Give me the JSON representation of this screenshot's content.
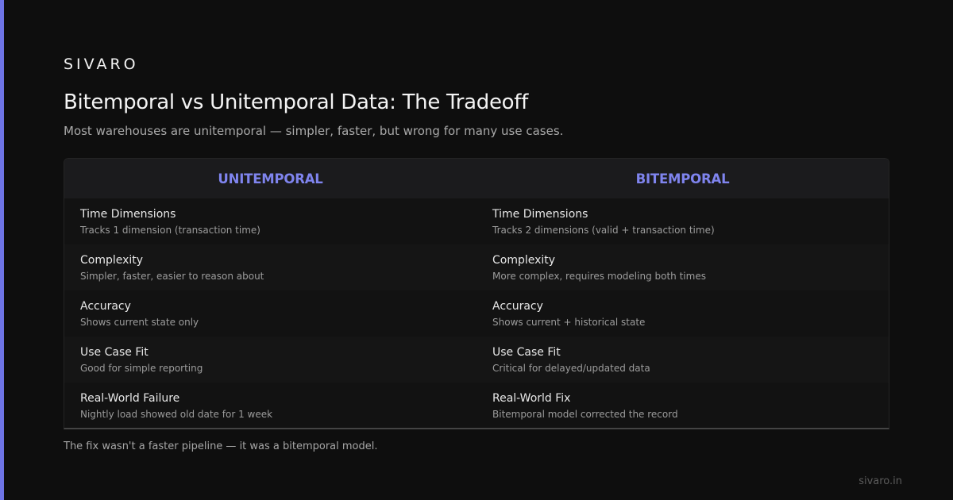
{
  "brand": "SIVARO",
  "title": "Bitemporal vs Unitemporal Data: The Tradeoff",
  "subtitle": "Most warehouses are unitemporal — simpler, faster, but wrong for many use cases.",
  "colors": {
    "accent": "#6e74e6",
    "header_text": "#7f84ee",
    "background": "#0e0e0e"
  },
  "columns": [
    "UNITEMPORAL",
    "BITEMPORAL"
  ],
  "rows": [
    {
      "left": {
        "label": "Time Dimensions",
        "desc": "Tracks 1 dimension (transaction time)"
      },
      "right": {
        "label": "Time Dimensions",
        "desc": "Tracks 2 dimensions (valid + transaction time)"
      }
    },
    {
      "left": {
        "label": "Complexity",
        "desc": "Simpler, faster, easier to reason about"
      },
      "right": {
        "label": "Complexity",
        "desc": "More complex, requires modeling both times"
      }
    },
    {
      "left": {
        "label": "Accuracy",
        "desc": "Shows current state only"
      },
      "right": {
        "label": "Accuracy",
        "desc": "Shows current + historical state"
      }
    },
    {
      "left": {
        "label": "Use Case Fit",
        "desc": "Good for simple reporting"
      },
      "right": {
        "label": "Use Case Fit",
        "desc": "Critical for delayed/updated data"
      }
    },
    {
      "left": {
        "label": "Real-World Failure",
        "desc": "Nightly load showed old date for 1 week"
      },
      "right": {
        "label": "Real-World Fix",
        "desc": "Bitemporal model corrected the record"
      }
    }
  ],
  "footnote": "The fix wasn't a faster pipeline — it was a bitemporal model.",
  "site": "sivaro.in"
}
